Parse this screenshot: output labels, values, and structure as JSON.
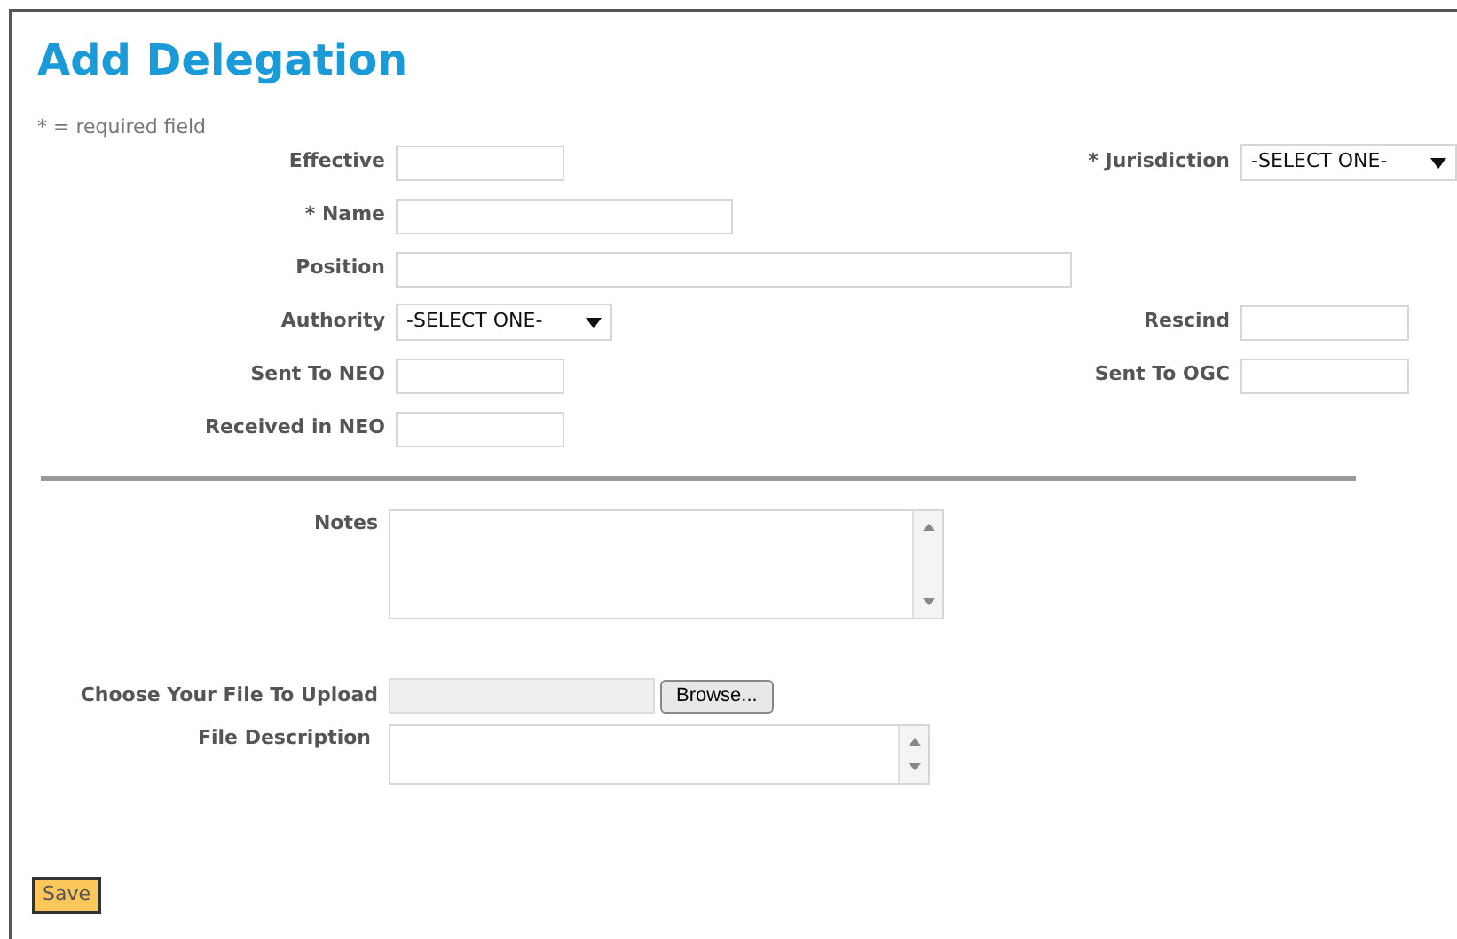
{
  "title": "Add Delegation",
  "required_note": "* = required field",
  "rows": [
    {
      "left": {
        "label": "Effective",
        "kind": "date"
      },
      "right": {
        "label": "* Jurisdiction",
        "kind": "select",
        "value": "-SELECT ONE-"
      }
    },
    {
      "left": {
        "label": "* Name",
        "kind": "text"
      }
    },
    {
      "left": {
        "label": "Position",
        "kind": "long_text"
      }
    },
    {
      "left": {
        "label": "Authority",
        "kind": "select",
        "value": "-SELECT ONE-"
      },
      "right": {
        "label": "Rescind",
        "kind": "date"
      }
    },
    {
      "left": {
        "label": "Sent To NEO",
        "kind": "date"
      },
      "right": {
        "label": "Sent To OGC",
        "kind": "date"
      }
    },
    {
      "left": {
        "label": "Received in NEO",
        "kind": "date"
      }
    }
  ],
  "notes": {
    "label": "Notes"
  },
  "upload": {
    "label": "Choose Your File To Upload",
    "button": "Browse..."
  },
  "file_description": {
    "label": "File Description"
  },
  "save_button": "Save"
}
